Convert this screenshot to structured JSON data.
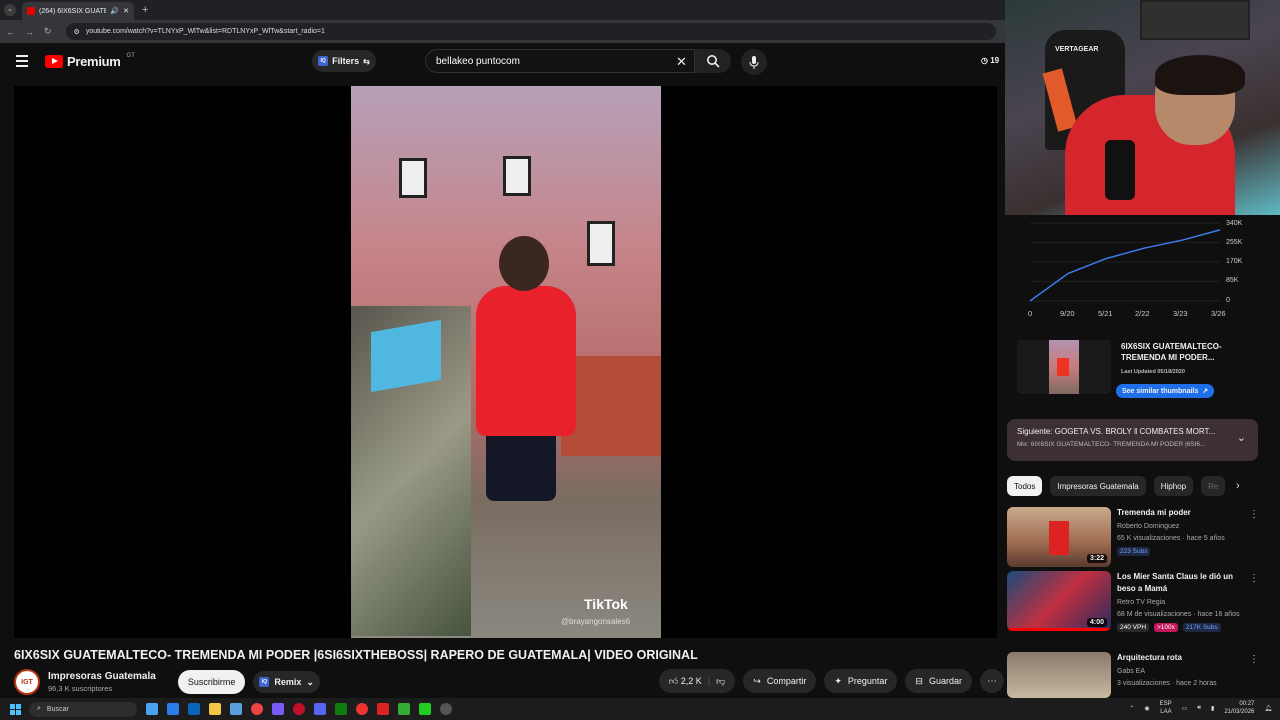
{
  "browser": {
    "tab_title": "(264) 6IX6SIX GUATEMALTE",
    "url": "youtube.com/watch?v=TLNYxP_WlTw&list=RDTLNYxP_WlTw&start_radio=1"
  },
  "header": {
    "logo_text": "Premium",
    "country": "GT",
    "filters_label": "Filters",
    "search_value": "bellakeo puntocom",
    "clock_partial": "19"
  },
  "video": {
    "watermark": "TikTok",
    "handle": "@brayangonsales6",
    "title": "6IX6SIX GUATEMALTECO- TREMENDA MI PODER |6SI6SIXTHEBOSS| RAPERO DE GUATEMALA| VIDEO ORIGINAL"
  },
  "channel": {
    "avatar_text": "IGT",
    "name": "Impresoras Guatemala",
    "subscribers": "96,3 K suscriptores",
    "subscribe_label": "Suscribirme",
    "remix_label": "Remix",
    "likes": "2,2 K",
    "share_label": "Compartir",
    "ask_label": "Preguntar",
    "save_label": "Guardar"
  },
  "webcam": {
    "chair_brand": "VERTAGEAR"
  },
  "views_graph": {
    "y_ticks": [
      "340K",
      "255K",
      "170K",
      "85K",
      "0"
    ],
    "x_ticks": [
      "0",
      "9/20",
      "5/21",
      "2/22",
      "3/23",
      "3/26"
    ]
  },
  "chart_data": {
    "type": "line",
    "categories": [
      "0",
      "9/20",
      "5/21",
      "2/22",
      "3/23",
      "3/26"
    ],
    "series": [
      {
        "values": [
          0,
          120000,
          185000,
          230000,
          265000,
          310000
        ]
      }
    ],
    "ylim": [
      0,
      340000
    ]
  },
  "thumb_info": {
    "title": "6IX6SIX GUATEMALTECO- TREMENDA MI PODER...",
    "last_updated": "Last Updated 05/18/2020",
    "similar_label": "See similar thumbnails"
  },
  "up_next": {
    "title": "Siguiente: GOGETA VS. BROLY ‖ COMBATES MORT...",
    "mix": "Mix: 6IX6SIX GUATEMALTECO- TREMENDA MI PODER |6SI6..."
  },
  "chips": [
    "Todos",
    "Impresoras Guatemala",
    "Hiphop",
    "Re"
  ],
  "recommendations": [
    {
      "title": "Tremenda mi poder",
      "channel": "Roberto Dominguez",
      "stats": "65 K visualizaciones · hace 5 años",
      "badges": [
        "223 Subs"
      ],
      "duration": "3:22"
    },
    {
      "title": "Los Mier Santa Claus le dió un beso a Mamá",
      "channel": "Retro TV Regia",
      "stats": "68 M de visualizaciones · hace 16 años",
      "badges": [
        "240 VPH",
        ">100x",
        "217K Subs"
      ],
      "duration": "4:00"
    },
    {
      "title": "Arquitectura rota",
      "channel": "Gabs EA",
      "stats": "3 visualizaciones · hace 2 horas",
      "badges": [],
      "duration": ""
    }
  ],
  "taskbar": {
    "search_label": "Buscar",
    "lang": "ESP",
    "lang2": "LAA",
    "time": "00:27",
    "date": "21/03/2026"
  }
}
